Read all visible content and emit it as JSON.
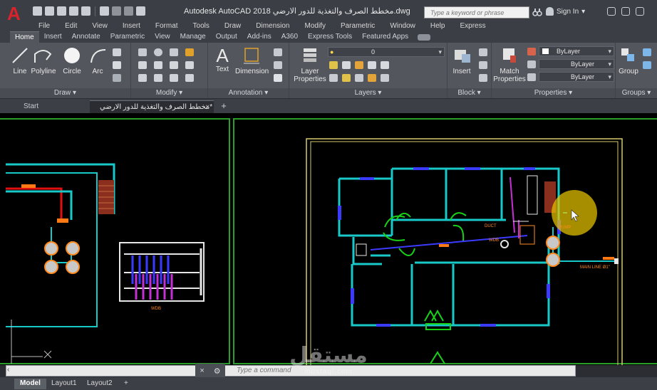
{
  "window": {
    "title": "Autodesk AutoCAD 2018   مخطط الصرف والتغذية للدور الارضي.dwg",
    "search_placeholder": "Type a keyword or phrase",
    "signin_label": "Sign In"
  },
  "menu": [
    "File",
    "Edit",
    "View",
    "Insert",
    "Format",
    "Tools",
    "Draw",
    "Dimension",
    "Modify",
    "Parametric",
    "Window",
    "Help",
    "Express"
  ],
  "ribbon_tabs": [
    "Home",
    "Insert",
    "Annotate",
    "Parametric",
    "View",
    "Manage",
    "Output",
    "Add-ins",
    "A360",
    "Express Tools",
    "Featured Apps"
  ],
  "ribbon": {
    "draw": {
      "title": "Draw",
      "line": "Line",
      "polyline": "Polyline",
      "circle": "Circle",
      "arc": "Arc"
    },
    "modify": {
      "title": "Modify"
    },
    "annotation": {
      "title": "Annotation",
      "text": "Text",
      "dimension": "Dimension"
    },
    "layers": {
      "title": "Layers",
      "layer_properties_line1": "Layer",
      "layer_properties_line2": "Properties",
      "current_layer": "0"
    },
    "block": {
      "title": "Block",
      "insert": "Insert"
    },
    "properties": {
      "title": "Properties",
      "match_line1": "Match",
      "match_line2": "Properties",
      "color": "ByLayer",
      "linetype": "ByLayer",
      "lineweight": "ByLayer"
    },
    "groups": {
      "title": "Groups",
      "group": "Group"
    }
  },
  "file_tabs": {
    "start": "Start",
    "document": "مخطط الصرف والتغذية للدور الارضي*"
  },
  "drawing_labels": {
    "wdb": "WDB",
    "duct": "DUCT",
    "wdb2": "WDB",
    "main_line": "MAIN LINE Ø1\"",
    "pump": "PUMP"
  },
  "command_line": {
    "placeholder": "Type a command"
  },
  "layout_tabs": [
    "Model",
    "Layout1",
    "Layout2"
  ],
  "watermark": {
    "arabic": "مستقل",
    "latin": "mostaql.com"
  },
  "colors": {
    "accent_red": "#d8232a",
    "pipe_cyan": "#00d8d8",
    "wall_cyan": "#17c9c9",
    "frame_yellow": "#d6c96b",
    "frame_green": "#2aa02a",
    "door_green": "#19d119",
    "pipe_blue": "#3b3bff",
    "pipe_magenta": "#c62fd6",
    "highlight": "#e7c400"
  }
}
